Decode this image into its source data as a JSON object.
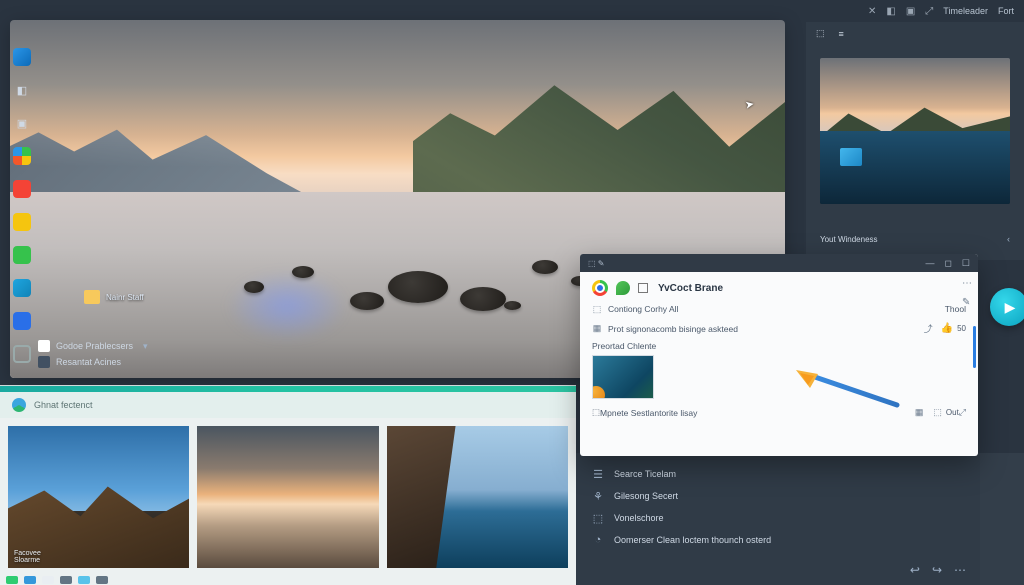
{
  "statusbar": {
    "right_tab_1": "Timeleader",
    "right_tab_2": "Fort",
    "indicators": [
      "✕",
      "◧",
      "▣",
      "⤢"
    ]
  },
  "desktop": {
    "folder_label": "Nainr Staff",
    "rows": [
      {
        "label": "Godoe Prablecsers"
      },
      {
        "label": "Resantat Acines"
      }
    ]
  },
  "right_panel": {
    "header_items": [
      "⬚",
      "≡"
    ],
    "caption": "Yout Windeness",
    "pager": "‹"
  },
  "browser": {
    "title": "Ghnat fectenct",
    "tiles": [
      {
        "caption": "Facovee\nSloarme"
      },
      {
        "caption": ""
      },
      {
        "caption": ""
      }
    ]
  },
  "ctx": {
    "rows": [
      {
        "icon": "☰",
        "label": "Searce Ticelam"
      },
      {
        "icon": "⚘",
        "label": "Gilesong Secert"
      },
      {
        "icon": "⬚",
        "label": "Vonelschore"
      },
      {
        "icon": "◔",
        "label": "Oomerser Clean loctem thounch osterd"
      }
    ],
    "actions": [
      "↩",
      "↪",
      "⋯"
    ]
  },
  "popup": {
    "titlebar_left": "⬚   ✎",
    "win_controls": [
      "—",
      "◻",
      "☐"
    ],
    "app_title": "YvCoct Brane",
    "row1_label": "Contiong Corhy All",
    "row1_right": "Thool",
    "row2_label": "Prot signonacomb bisinge askteed",
    "row2_count": "50",
    "thumb_label": "Preortad Chlente",
    "footer_label": "Mpnete Sestlantorite lisay",
    "footer_right": "Out",
    "side_opts": [
      "⋯",
      "✎"
    ]
  }
}
